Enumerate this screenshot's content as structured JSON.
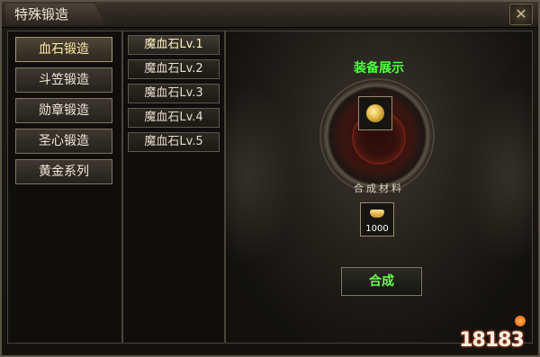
{
  "window": {
    "title": "特殊锻造",
    "close_icon": "close-x-icon"
  },
  "categories": [
    {
      "label": "血石锻造",
      "active": true
    },
    {
      "label": "斗笠锻造",
      "active": false
    },
    {
      "label": "勋章锻造",
      "active": false
    },
    {
      "label": "圣心锻造",
      "active": false
    },
    {
      "label": "黄金系列",
      "active": false
    }
  ],
  "subitems": [
    {
      "label": "魔血石Lv.1",
      "active": true
    },
    {
      "label": "魔血石Lv.2",
      "active": false
    },
    {
      "label": "魔血石Lv.3",
      "active": false
    },
    {
      "label": "魔血石Lv.4",
      "active": false
    },
    {
      "label": "魔血石Lv.5",
      "active": false
    }
  ],
  "display": {
    "title": "装备展示",
    "item_icon": "blood-stone-gem-icon",
    "materials_label": "合成材料",
    "material_icon": "gold-ingot-icon",
    "material_count": "1000",
    "craft_button": "合成"
  },
  "watermark": {
    "text": "18183"
  },
  "colors": {
    "accent_green": "#4cff3b",
    "title_text": "#e8e2d0",
    "frame": "#5b5347"
  }
}
